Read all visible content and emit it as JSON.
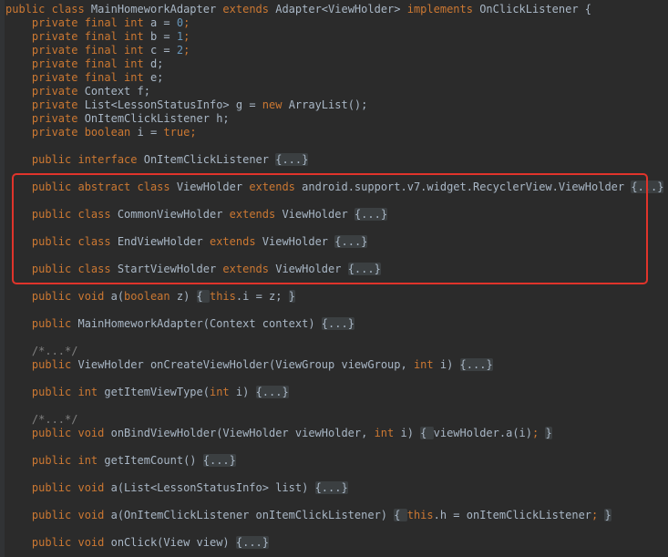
{
  "code": {
    "l01": [
      "public class ",
      "MainHomeworkAdapter ",
      "extends ",
      "Adapter<ViewHolder> ",
      "implements ",
      "OnClickListener {"
    ],
    "l02": [
      "    private final int ",
      "a",
      " = ",
      "0",
      ";"
    ],
    "l03": [
      "    private final int ",
      "b",
      " = ",
      "1",
      ";"
    ],
    "l04": [
      "    private final int ",
      "c",
      " = ",
      "2",
      ";"
    ],
    "l05": [
      "    private final int ",
      "d;"
    ],
    "l06": [
      "    private final int ",
      "e;"
    ],
    "l07": [
      "    private ",
      "Context f;"
    ],
    "l08": [
      "    private ",
      "List<LessonStatusInfo> g = ",
      "new ",
      "ArrayList();"
    ],
    "l09": [
      "    private ",
      "OnItemClickListener h;"
    ],
    "l10": [
      "    private boolean ",
      "i = ",
      "true",
      ";"
    ],
    "l11": [
      "    public interface ",
      "OnItemClickListener ",
      "{...}"
    ],
    "l12": [
      "    public abstract class ",
      "ViewHolder ",
      "extends ",
      "android.support.v7.widget.RecyclerView.ViewHolder ",
      "{...}"
    ],
    "l13": [
      "    public class ",
      "CommonViewHolder ",
      "extends ",
      "ViewHolder ",
      "{...}"
    ],
    "l14": [
      "    public class ",
      "EndViewHolder ",
      "extends ",
      "ViewHolder ",
      "{...}"
    ],
    "l15": [
      "    public class ",
      "StartViewHolder ",
      "extends ",
      "ViewHolder ",
      "{...}"
    ],
    "l16": [
      "    public void ",
      "a(",
      "boolean ",
      "z) ",
      "{ ",
      "this",
      ".i = z; ",
      "}"
    ],
    "l17": [
      "    public ",
      "MainHomeworkAdapter(Context context) ",
      "{...}"
    ],
    "l18": [
      "    /*...*/"
    ],
    "l19": [
      "    public ",
      "ViewHolder onCreateViewHolder(ViewGroup viewGroup, ",
      "int ",
      "i) ",
      "{...}"
    ],
    "l20": [
      "    public int ",
      "getItemViewType(",
      "int ",
      "i) ",
      "{...}"
    ],
    "l21": [
      "    /*...*/"
    ],
    "l22": [
      "    public void ",
      "onBindViewHolder(ViewHolder viewHolder, ",
      "int ",
      "i) ",
      "{ ",
      "viewHolder.a(i)",
      "; ",
      "}"
    ],
    "l23": [
      "    public int ",
      "getItemCount() ",
      "{...}"
    ],
    "l24": [
      "    public void ",
      "a(List<LessonStatusInfo> list) ",
      "{...}"
    ],
    "l25": [
      "    public void ",
      "a(OnItemClickListener onItemClickListener) ",
      "{ ",
      "this",
      ".h = onItemClickListener",
      "; ",
      "}"
    ],
    "l26": [
      "    public void ",
      "onClick(View view) ",
      "{...}"
    ]
  },
  "highlight": {
    "color": "#e0342b"
  },
  "colors": {
    "background": "#2b2b2b",
    "keyword": "#cc7832",
    "number": "#6897bb",
    "comment": "#808080",
    "text": "#a9b7c6"
  }
}
